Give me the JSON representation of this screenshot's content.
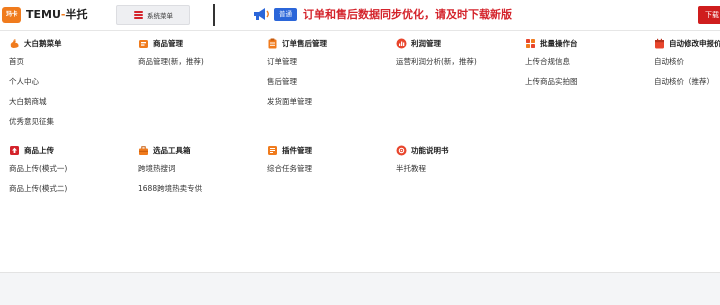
{
  "topbar": {
    "logo_text": "玛卡",
    "app_title_prefix": "TEMU",
    "app_title_dash": "-",
    "app_title_suffix": "半托",
    "menu_tab_label": "系统菜单",
    "notice_badge": "普通",
    "notice_text": "订单和售后数据同步优化，请及时下载新版",
    "download_label": "下载"
  },
  "colors": {
    "brand_orange": "#f07b1d",
    "accent_red": "#d4232b",
    "badge_blue": "#2b66d9"
  },
  "groups": [
    {
      "title": "大白鹅菜单",
      "icon": "goose-icon",
      "color": "#f07b1d",
      "items": [
        "首页",
        "个人中心",
        "大白鹅商城",
        "优秀意见征集"
      ]
    },
    {
      "title": "商品管理",
      "icon": "box-icon",
      "color": "#f07b1d",
      "items": [
        "商品管理(新，推荐)"
      ]
    },
    {
      "title": "订单售后管理",
      "icon": "clipboard-icon",
      "color": "#f07b1d",
      "items": [
        "订单管理",
        "售后管理",
        "发货面单管理"
      ]
    },
    {
      "title": "利润管理",
      "icon": "chart-icon",
      "color": "#e8452c",
      "items": [
        "运营利润分析(新，推荐)"
      ]
    },
    {
      "title": "批量操作台",
      "icon": "grid-icon",
      "color": "#e8452c",
      "items": [
        "上传合规信息",
        "上传商品实拍图"
      ]
    },
    {
      "title": "自动修改申报价",
      "icon": "calendar-icon",
      "color": "#e8452c",
      "items": [
        "自动核价",
        "自动核价（推荐）"
      ]
    },
    {
      "title": "商品上传",
      "icon": "upload-icon",
      "color": "#d4232b",
      "items": [
        "商品上传(模式一)",
        "商品上传(模式二)"
      ]
    },
    {
      "title": "选品工具箱",
      "icon": "toolbox-icon",
      "color": "#f07b1d",
      "items": [
        "跨境热搜词",
        "1688跨境热卖专供"
      ]
    },
    {
      "title": "插件管理",
      "icon": "plugin-icon",
      "color": "#f07b1d",
      "items": [
        "综合任务管理"
      ]
    },
    {
      "title": "功能说明书",
      "icon": "manual-icon",
      "color": "#e8452c",
      "items": [
        "半托教程"
      ]
    }
  ]
}
